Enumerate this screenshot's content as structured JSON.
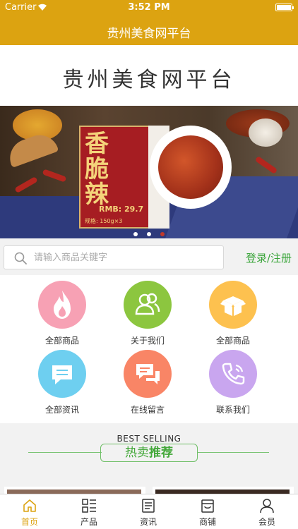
{
  "status_bar": {
    "carrier": "Carrier",
    "time": "3:52 PM"
  },
  "nav": {
    "title": "贵州美食网平台"
  },
  "logo": {
    "text": "贵州美食网平台"
  },
  "banner": {
    "product_title": "香脆辣",
    "price_label": "RMB: 29.7",
    "spec_label": "规格: 150g×3",
    "slide_count": 3,
    "active_slide": 2
  },
  "search": {
    "placeholder": "请输入商品关键字",
    "value": ""
  },
  "auth": {
    "login_label": "登录/注册"
  },
  "menu": {
    "items": [
      {
        "label": "全部商品",
        "icon": "flame-icon",
        "color": "#f7a1b4"
      },
      {
        "label": "关于我们",
        "icon": "users-icon",
        "color": "#8cc63f"
      },
      {
        "label": "全部商品",
        "icon": "box-icon",
        "color": "#fdc14f"
      },
      {
        "label": "全部资讯",
        "icon": "message-icon",
        "color": "#6ecff0"
      },
      {
        "label": "在线留言",
        "icon": "chat-icon",
        "color": "#f98566"
      },
      {
        "label": "联系我们",
        "icon": "phone-icon",
        "color": "#c9a6ef"
      }
    ]
  },
  "hot_section": {
    "subtitle": "BEST SELLING",
    "title_part1": "热卖",
    "title_part2": "推荐"
  },
  "tabbar": {
    "items": [
      {
        "label": "首页",
        "icon": "home-icon",
        "active": true
      },
      {
        "label": "产品",
        "icon": "grid-icon",
        "active": false
      },
      {
        "label": "资讯",
        "icon": "news-icon",
        "active": false
      },
      {
        "label": "商铺",
        "icon": "store-icon",
        "active": false
      },
      {
        "label": "会员",
        "icon": "user-icon",
        "active": false
      }
    ]
  },
  "colors": {
    "brand": "#dca311",
    "accent_green": "#43a839"
  }
}
